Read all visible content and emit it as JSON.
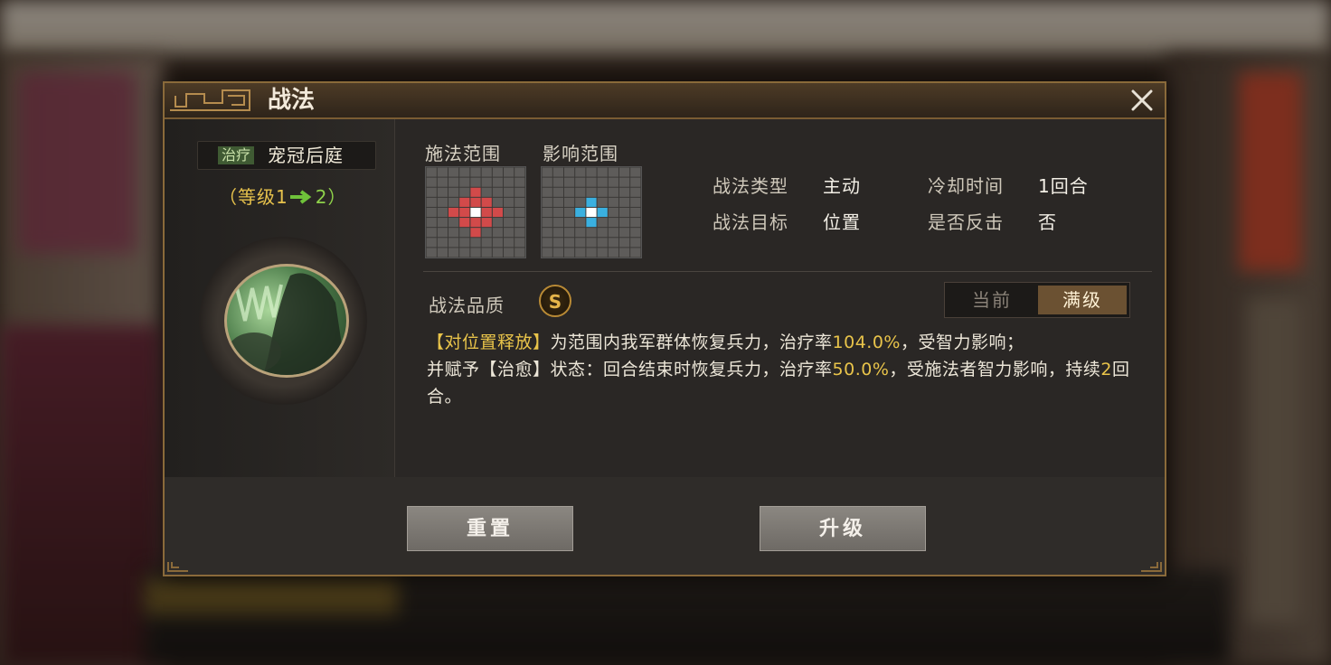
{
  "dialog": {
    "title": "战法",
    "close_label": "×"
  },
  "skill": {
    "type_tag": "治疗",
    "name": "宠冠后庭",
    "level_prefix": "（等级1",
    "level_to": "2）"
  },
  "ranges": {
    "cast_label": "施法范围",
    "effect_label": "影响范围",
    "cast_color": "#d24a4a",
    "effect_color": "#3ab0e0"
  },
  "info": {
    "type_label": "战法类型",
    "type_value": "主动",
    "cooldown_label": "冷却时间",
    "cooldown_value": "1回合",
    "target_label": "战法目标",
    "target_value": "位置",
    "counter_label": "是否反击",
    "counter_value": "否"
  },
  "quality": {
    "label": "战法品质",
    "grade": "S"
  },
  "level_toggle": {
    "current": "当前",
    "max": "满级",
    "selected": "max"
  },
  "description": {
    "p1_tag": "【对位置释放】",
    "p1_text": "为范围内我军群体恢复兵力，治疗率",
    "p1_rate": "104.0%",
    "p1_tail": "，受智力影响；",
    "p2_head": "并赋予【治愈】状态：回合结束时恢复兵力，治疗率",
    "p2_rate": "50.0%",
    "p2_tail": "，受施法者智力影响，持续",
    "p2_turns": "2",
    "p2_end": "回合。"
  },
  "buttons": {
    "reset": "重置",
    "upgrade": "升级"
  }
}
